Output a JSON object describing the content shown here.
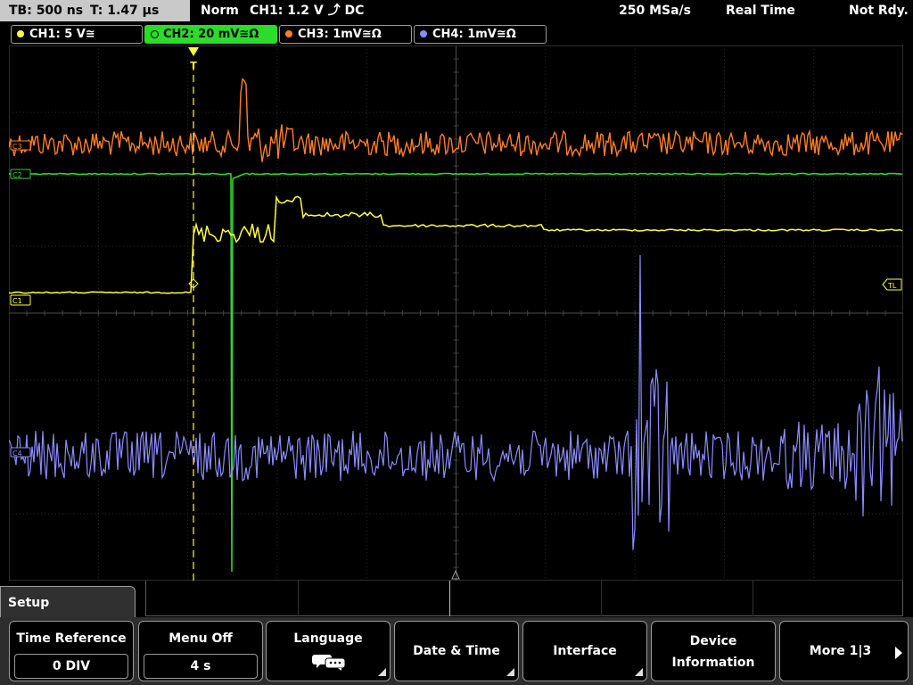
{
  "topbar": {
    "timebase": "TB: 500 ns",
    "trigger_time": "T: 1.47 µs",
    "mode": "Norm",
    "trigger_info": "CH1: 1.2 V ⤴ DC",
    "sample_rate": "250 MSa/s",
    "acq_mode": "Real Time",
    "status": "Not Rdy."
  },
  "channels": [
    {
      "id": "ch1",
      "label": "CH1: 5 V≅",
      "color": "#ffff3c",
      "active": false
    },
    {
      "id": "ch2",
      "label": "CH2: 20 mV≅Ω",
      "color": "#32d232",
      "active": true
    },
    {
      "id": "ch3",
      "label": "CH3: 1mV≅Ω",
      "color": "#ff7f24",
      "active": false
    },
    {
      "id": "ch4",
      "label": "CH4: 1mV≅Ω",
      "color": "#8c8cff",
      "active": false
    }
  ],
  "screen": {
    "markers": {
      "c1": "C1",
      "c2": "C2",
      "c3": "C3",
      "c4": "C4",
      "trigger_level": "TL",
      "trigger_pos": "T"
    }
  },
  "menu": {
    "title": "Setup",
    "softkeys": [
      {
        "name": "time-reference",
        "label": "Time Reference",
        "value": "0 DIV"
      },
      {
        "name": "menu-off",
        "label": "Menu Off",
        "value": "4 s"
      },
      {
        "name": "language",
        "label": "Language",
        "icon": "speech-bubbles-icon"
      },
      {
        "name": "date-time",
        "label": "Date & Time"
      },
      {
        "name": "interface",
        "label": "Interface"
      },
      {
        "name": "device-information",
        "label_line1": "Device",
        "label_line2": "Information"
      },
      {
        "name": "more",
        "label": "More 1|3"
      }
    ]
  }
}
